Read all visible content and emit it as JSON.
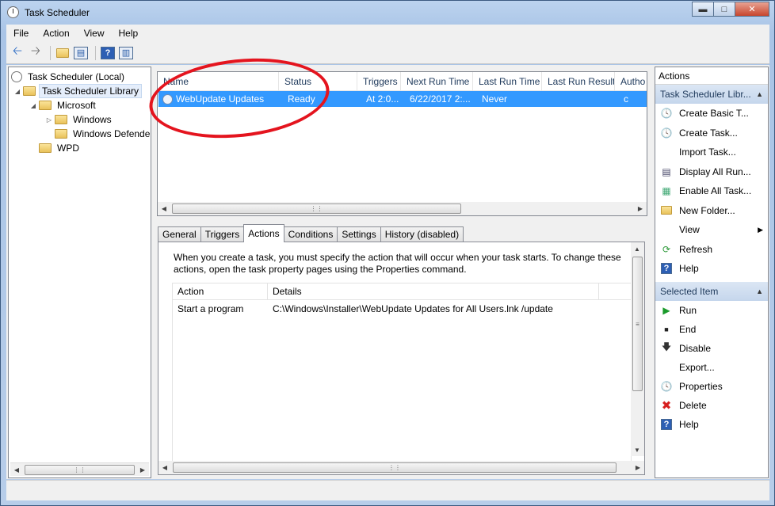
{
  "window": {
    "title": "Task Scheduler"
  },
  "menu": [
    "File",
    "Action",
    "View",
    "Help"
  ],
  "toolbar": {
    "buttons": [
      "back-icon",
      "forward-icon",
      "up-folder-icon",
      "show-hide-console-tree-icon",
      "help-icon",
      "show-hide-action-pane-icon"
    ]
  },
  "tree": {
    "root": "Task Scheduler (Local)",
    "library": "Task Scheduler Library",
    "microsoft": "Microsoft",
    "windows": "Windows",
    "windows_defender": "Windows Defende",
    "wpd": "WPD"
  },
  "task_list": {
    "columns": [
      "Name",
      "Status",
      "Triggers",
      "Next Run Time",
      "Last Run Time",
      "Last Run Result",
      "Autho"
    ],
    "rows": [
      {
        "name": "WebUpdate Updates",
        "status": "Ready",
        "triggers": "At 2:0...",
        "next_run": "6/22/2017 2:...",
        "last_run": "Never",
        "last_result": "",
        "author": "c"
      }
    ]
  },
  "detail_tabs": [
    "General",
    "Triggers",
    "Actions",
    "Conditions",
    "Settings",
    "History (disabled)"
  ],
  "actions_tab": {
    "description": "When you create a task, you must specify the action that will occur when your task starts.  To change these actions, open the task property pages using the Properties command.",
    "columns": [
      "Action",
      "Details"
    ],
    "rows": [
      {
        "action": "Start a program",
        "details": "C:\\Windows\\Installer\\WebUpdate Updates for All Users.lnk /update"
      }
    ]
  },
  "actions_pane": {
    "header": "Actions",
    "section1": "Task Scheduler Libr...",
    "items1": [
      {
        "label": "Create Basic T...",
        "icon": "create-basic-task-icon"
      },
      {
        "label": "Create Task...",
        "icon": "create-task-icon"
      },
      {
        "label": "Import Task...",
        "icon": ""
      },
      {
        "label": "Display All Run...",
        "icon": "display-running-icon"
      },
      {
        "label": "Enable All Task...",
        "icon": "enable-history-icon"
      },
      {
        "label": "New Folder...",
        "icon": "new-folder-icon"
      },
      {
        "label": "View",
        "icon": ""
      },
      {
        "label": "Refresh",
        "icon": "refresh-icon"
      },
      {
        "label": "Help",
        "icon": "help-icon"
      }
    ],
    "section2": "Selected Item",
    "items2": [
      {
        "label": "Run",
        "icon": "run-icon"
      },
      {
        "label": "End",
        "icon": "end-icon"
      },
      {
        "label": "Disable",
        "icon": "disable-icon"
      },
      {
        "label": "Export...",
        "icon": ""
      },
      {
        "label": "Properties",
        "icon": "properties-icon"
      },
      {
        "label": "Delete",
        "icon": "delete-icon"
      },
      {
        "label": "Help",
        "icon": "help-icon"
      }
    ]
  },
  "colors": {
    "selection": "#3399ff",
    "annotation": "#e4141e"
  }
}
